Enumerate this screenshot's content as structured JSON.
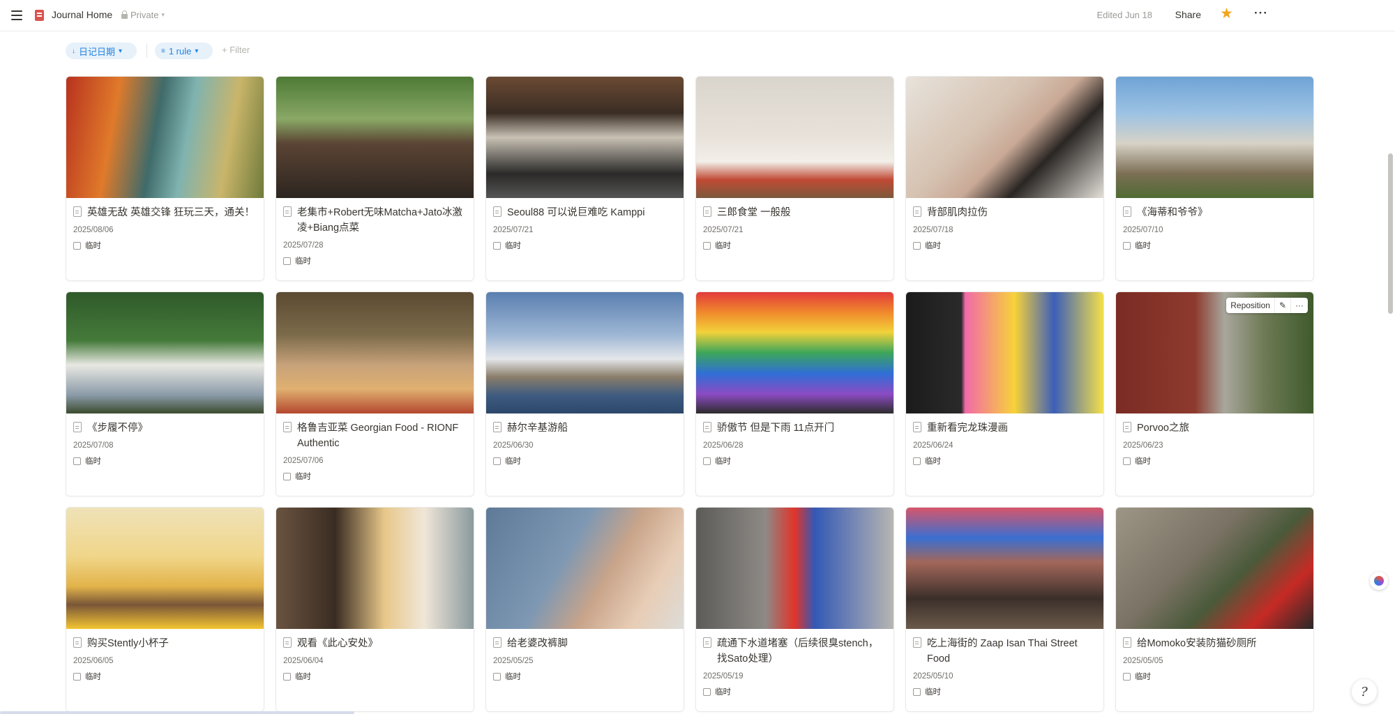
{
  "topbar": {
    "title": "Journal Home",
    "privacy": "Private",
    "edited": "Edited Jun 18",
    "share_label": "Share"
  },
  "toolbar": {
    "sort_label": "日记日期",
    "rule_label": "1 rule",
    "filter_label": "Filter"
  },
  "cover_actions": {
    "reposition": "Reposition"
  },
  "cards": [
    {
      "title": "英雄无敌 英雄交锋 狂玩三天，通关！",
      "date": "2025/08/06",
      "tag": "临时",
      "cover": "fantasy-game-art"
    },
    {
      "title": "老集市+Robert无味Matcha+Jato冰激凌+Biang点菜",
      "date": "2025/07/28",
      "tag": "临时",
      "cover": "market-gate"
    },
    {
      "title": "Seoul88 可以说巨难吃 Kamppi",
      "date": "2025/07/21",
      "tag": "临时",
      "cover": "restaurant-interior"
    },
    {
      "title": "三郎食堂 一般般",
      "date": "2025/07/21",
      "tag": "临时",
      "cover": "dining-table"
    },
    {
      "title": "背部肌肉拉伤",
      "date": "2025/07/18",
      "tag": "临时",
      "cover": "back-photo"
    },
    {
      "title": "《海蒂和爷爷》",
      "date": "2025/07/10",
      "tag": "临时",
      "cover": "movie-still-alps"
    },
    {
      "title": "《步履不停》",
      "date": "2025/07/08",
      "tag": "临时",
      "cover": "family-photo"
    },
    {
      "title": "格鲁吉亚菜  Georgian Food - RIONF Authentic",
      "date": "2025/07/06",
      "tag": "临时",
      "cover": "georgian-food"
    },
    {
      "title": "赫尔辛基游船",
      "date": "2025/06/30",
      "tag": "临时",
      "cover": "helsinki-harbor"
    },
    {
      "title": "骄傲节 但是下雨 11点开门",
      "date": "2025/06/28",
      "tag": "临时",
      "cover": "pride-flags"
    },
    {
      "title": "重新看完龙珠漫画",
      "date": "2025/06/24",
      "tag": "临时",
      "cover": "manga-cover"
    },
    {
      "title": "Porvoo之旅",
      "date": "2025/06/23",
      "tag": "临时",
      "cover": "porvoo-street"
    },
    {
      "title": "购买Stently小杯子",
      "date": "2025/06/05",
      "tag": "临时",
      "cover": "cat-illustration"
    },
    {
      "title": "观看《此心安处》",
      "date": "2025/06/04",
      "tag": "临时",
      "cover": "birthday-movie"
    },
    {
      "title": "给老婆改裤脚",
      "date": "2025/05/25",
      "tag": "临时",
      "cover": "jeans-closeup"
    },
    {
      "title": "疏通下水道堵塞（后续很臭stench，找Sato处理）",
      "date": "2025/05/19",
      "tag": "临时",
      "cover": "drain-cleaner"
    },
    {
      "title": "吃上海街的 Zaap Isan Thai Street Food",
      "date": "2025/05/10",
      "tag": "临时",
      "cover": "thai-restaurant"
    },
    {
      "title": "给Momoko安装防猫砂厕所",
      "date": "2025/05/05",
      "tag": "临时",
      "cover": "drill-install"
    }
  ],
  "colors": {
    "accent": "#2383e2",
    "chip_bg": "#e7f1fa",
    "star": "#f2a51c",
    "page_icon": "#d9534f"
  }
}
